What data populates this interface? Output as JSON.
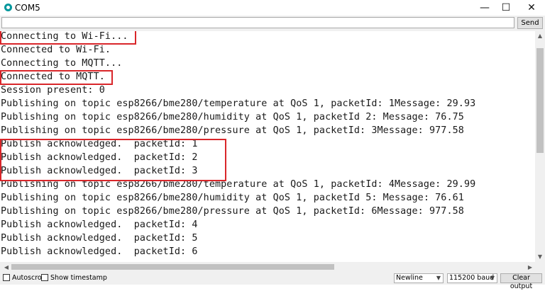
{
  "window": {
    "title": "COM5",
    "minimize_glyph": "—",
    "maximize_glyph": "☐",
    "close_glyph": "✕",
    "icon": "arduino-icon",
    "accent": "#00979c"
  },
  "send": {
    "input_value": "",
    "button_label": "Send"
  },
  "output": {
    "lines": [
      "Connecting to Wi-Fi...",
      "Connected to Wi-Fi.",
      "Connecting to MQTT...",
      "Connected to MQTT.",
      "Session present: 0",
      "Publishing on topic esp8266/bme280/temperature at QoS 1, packetId: 1Message: 29.93",
      "Publishing on topic esp8266/bme280/humidity at QoS 1, packetId 2: Message: 76.75",
      "Publishing on topic esp8266/bme280/pressure at QoS 1, packetId: 3Message: 977.58",
      "Publish acknowledged.  packetId: 1",
      "Publish acknowledged.  packetId: 2",
      "Publish acknowledged.  packetId: 3",
      "Publishing on topic esp8266/bme280/temperature at QoS 1, packetId: 4Message: 29.99",
      "Publishing on topic esp8266/bme280/humidity at QoS 1, packetId 5: Message: 76.61",
      "Publishing on topic esp8266/bme280/pressure at QoS 1, packetId: 6Message: 977.58",
      "Publish acknowledged.  packetId: 4",
      "Publish acknowledged.  packetId: 5",
      "Publish acknowledged.  packetId: 6"
    ],
    "highlight_color": "#d9262a"
  },
  "status": {
    "autoscroll_label": "Autoscroll",
    "autoscroll_checked": false,
    "timestamp_label": "Show timestamp",
    "timestamp_checked": false,
    "line_ending": "Newline",
    "baud_rate": "115200 baud",
    "clear_label": "Clear output"
  }
}
